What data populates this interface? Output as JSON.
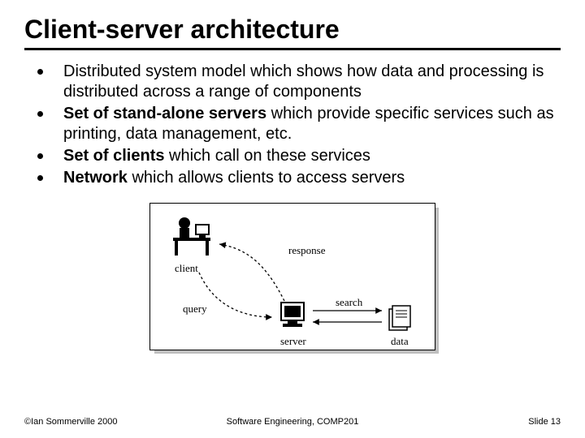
{
  "title": "Client-server architecture",
  "bullets": [
    {
      "prefix": "",
      "bold": "",
      "rest": "Distributed system model which shows how data and processing is distributed across a range of components"
    },
    {
      "prefix": "",
      "bold": "Set of stand-alone servers",
      "rest": " which provide specific services such as printing, data management, etc."
    },
    {
      "prefix": "",
      "bold": "Set of clients",
      "rest": " which call on these services"
    },
    {
      "prefix": "",
      "bold": "Network",
      "rest": " which allows clients to access servers"
    }
  ],
  "diagram": {
    "labels": {
      "client": "client",
      "response": "response",
      "query": "query",
      "server": "server",
      "search": "search",
      "data": "data"
    }
  },
  "footer": {
    "left": "©Ian Sommerville 2000",
    "center": "Software Engineering, COMP201",
    "right": "Slide 13"
  }
}
